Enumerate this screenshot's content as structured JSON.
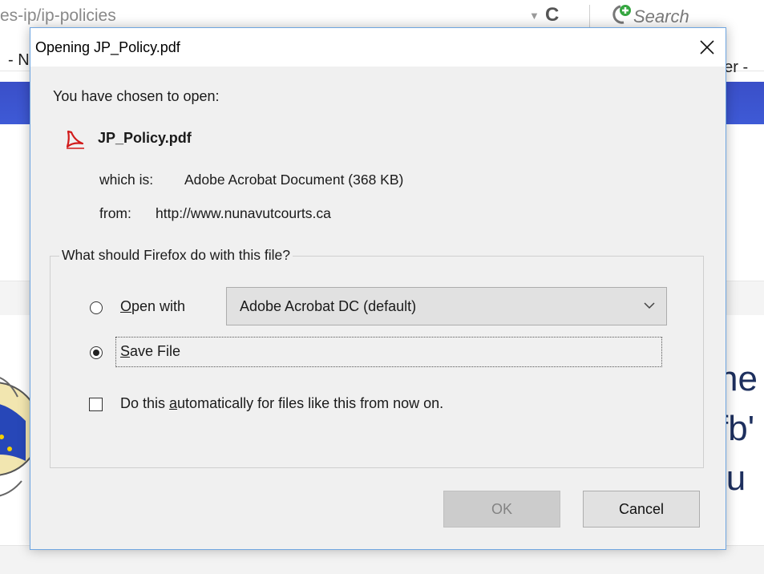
{
  "background": {
    "url_fragment": "es-ip/ip-policies",
    "search_placeholder": "Search",
    "tab_left": "- N",
    "tab_right": "ner - ",
    "big_text_lines": [
      "he",
      "fb'",
      "ju"
    ],
    "colors": {
      "blue_band": "#3e56d2",
      "heading_text": "#1d2f5e"
    }
  },
  "dialog": {
    "title": "Opening JP_Policy.pdf",
    "chosen_text": "You have chosen to open:",
    "file": {
      "name": "JP_Policy.pdf",
      "icon": "pdf-icon",
      "which_label": "which is:",
      "which_value": "Adobe Acrobat Document (368 KB)",
      "from_label": "from:",
      "from_value": "http://www.nunavutcourts.ca"
    },
    "group_legend": "What should Firefox do with this file?",
    "options": {
      "open_with": {
        "prefix": "",
        "accel": "O",
        "rest": "pen with",
        "checked": false
      },
      "save_file": {
        "accel": "S",
        "rest": "ave File",
        "checked": true
      },
      "app_select_value": "Adobe Acrobat DC  (default)",
      "auto": {
        "pre": "Do this ",
        "accel": "a",
        "rest": "utomatically for files like this from now on.",
        "checked": false
      }
    },
    "buttons": {
      "ok": "OK",
      "cancel": "Cancel",
      "ok_disabled": true
    },
    "colors": {
      "border": "#6ea5e0",
      "face": "#f0f0f0"
    }
  }
}
